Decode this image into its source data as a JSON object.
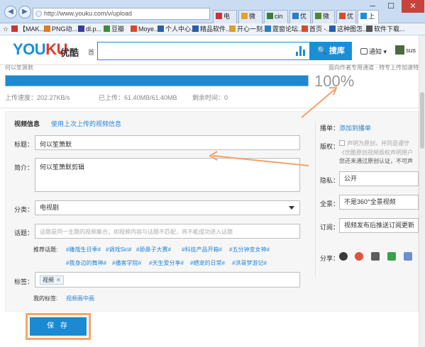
{
  "browser": {
    "url": "http://www.youku.com/v/upload",
    "tabs": [
      {
        "label": "电",
        "color": "#c33"
      },
      {
        "label": "微",
        "color": "#e2a22b"
      },
      {
        "label": "cin",
        "color": "#3b7d3b"
      },
      {
        "label": "优",
        "color": "#2a7fc8"
      },
      {
        "label": "微",
        "color": "#4a8a2a"
      },
      {
        "label": "优",
        "color": "#d94a2a"
      },
      {
        "label": "上",
        "color": "#1a8fd8"
      }
    ],
    "bookmarks": [
      {
        "label": "【MAK...",
        "color": "#c33"
      },
      {
        "label": "PNG动...",
        "color": "#e07b20"
      },
      {
        "label": "dl.p...",
        "color": "#3b3b9b"
      },
      {
        "label": "豆瓣",
        "color": "#3b8d3b"
      },
      {
        "label": "Moye...",
        "color": "#d94a2a"
      },
      {
        "label": "个人中心...",
        "color": "#2a5fa8"
      },
      {
        "label": "精品软件...",
        "color": "#2a5fa8"
      },
      {
        "label": "开心一刻...",
        "color": "#d9a02a"
      },
      {
        "label": "霆窗论坛...",
        "color": "#2a7fc8"
      },
      {
        "label": "首页 -...",
        "color": "#d94a2a"
      },
      {
        "label": "这种图怎...",
        "color": "#2a5fa8"
      },
      {
        "label": "软件下载...",
        "color": "#555"
      }
    ],
    "window_buttons": {
      "minimize": "─",
      "maximize": "☐",
      "close": "✕"
    }
  },
  "header": {
    "logo_you": "YOU",
    "logo_ku": "KU",
    "logo_cn": "优酷",
    "home_link": "首",
    "search_button": "搜库",
    "notice": "通知 ▾",
    "user": "sus"
  },
  "upload": {
    "title_clipped": "何以笙箫默",
    "note_clipped": "面向作者专用通道 · 特专上传加速特",
    "percent_text": "100%",
    "progress": 1.0,
    "speed": "上传速度：202.27KB/s",
    "uploaded": "已上传：61.40MB/61.40MB",
    "remaining": "剩余时间：0"
  },
  "form": {
    "section_title": "视频信息",
    "reuse_link": "使用上次上传的视频信息",
    "title_label": "标题：",
    "title_value": "何以笙箫默",
    "intro_label": "简介：",
    "intro_value": "何以笙箫默剪辑",
    "category_label": "分类：",
    "category_value": "电视剧",
    "topic_label": "话题：",
    "topic_placeholder": "话题是同一主题的视频集合；如视频内容与话题不匹配，将不能成功进入话题",
    "hot_topics_label": "推荐话题:",
    "hot_topics": [
      "#雕哉生日季#",
      "#调戏Siri#",
      "#舔鼻子大赛#",
      "#科技产品开箱#",
      "#五分钟变女神#",
      "#我身边的舞神#",
      "#播客学院#",
      "#天生爱分享#",
      "#晒宠的日常#",
      "#洪哥梦游记#"
    ],
    "tags_label": "标签：",
    "tag_value": "视频",
    "tag_remove": "✕",
    "my_tags_label": "我的标签:",
    "my_tags_link": "视频画中画",
    "save_button": "保 存"
  },
  "side": {
    "playlist_label": "播单：",
    "playlist_link": "添加到播单",
    "copyright_label": "版权：",
    "copyright_check": "声明为原创，并同意遵守",
    "copyright_line2": "《优酷原创视频版权声明用户",
    "copyright_line3": "您还未通过原创认证，不可声",
    "copyright_link": "原创认证",
    "privacy_label": "隐私：",
    "privacy_value": "公开",
    "panorama_label": "全景：",
    "panorama_value": "不是360°全景视频",
    "subscribe_label": "订阅：",
    "subscribe_value": "视频发布后推送订阅更新",
    "share_label": "分享："
  },
  "colors": {
    "accent": "#1a8fd8",
    "progress": "#1b8ad3",
    "arrow": "#f5a06a",
    "logo_red": "#e43a2c"
  }
}
